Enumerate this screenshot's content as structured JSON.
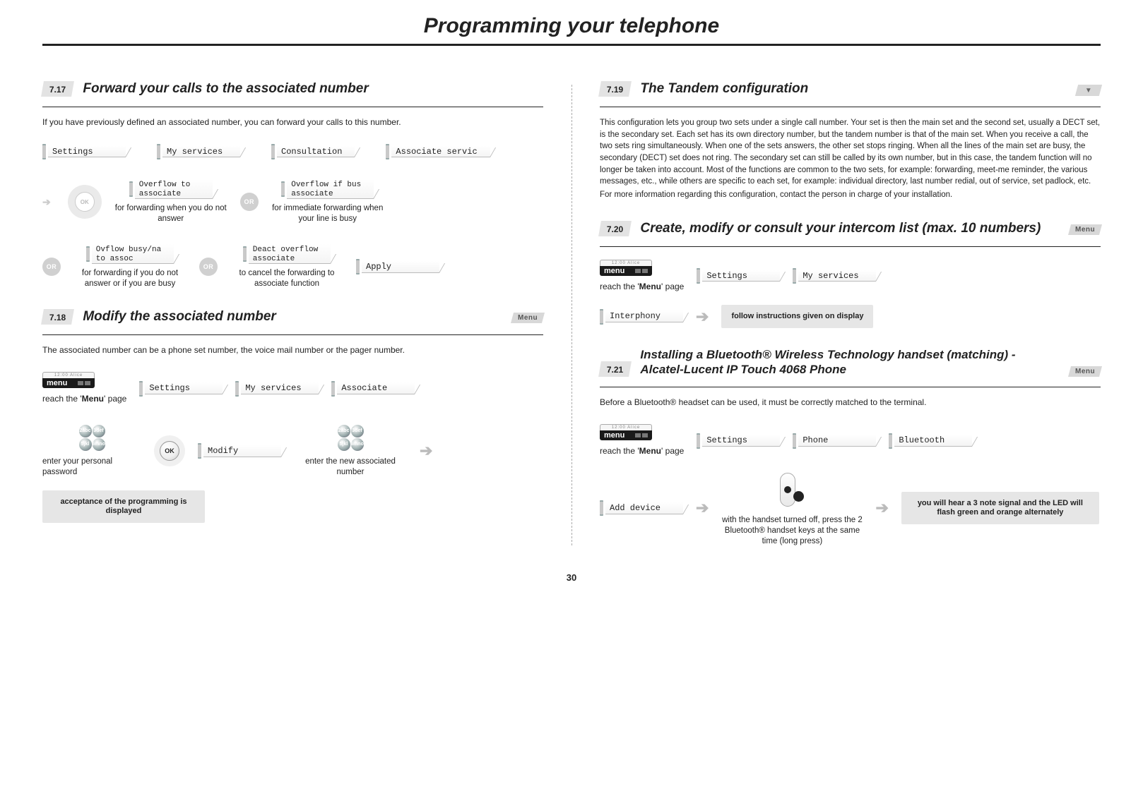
{
  "page_title": "Programming your telephone",
  "page_number": "30",
  "badges": {
    "menu": "Menu",
    "or": "OR",
    "ok": "OK",
    "v": "▼"
  },
  "left": {
    "s17": {
      "num": "7.17",
      "title": "Forward your calls to the associated number",
      "intro": "If you have previously defined an associated number, you can forward your calls to this number.",
      "row1": [
        "Settings",
        "My services",
        "Consultation",
        "Associate servic"
      ],
      "row2a_line1": "Overflow to",
      "row2a_line2": "associate",
      "row2a_cap": "for forwarding when you do not answer",
      "row2b_line1": "Overflow if bus",
      "row2b_line2": "associate",
      "row2b_cap": "for immediate forwarding when your line is busy",
      "row3a_line1": "Ovflow busy/na",
      "row3a_line2": "to assoc",
      "row3a_cap": "for forwarding if you do not answer or if you are busy",
      "row3b_line1": "Deact overflow",
      "row3b_line2": "associate",
      "row3b_cap": "to cancel the forwarding to associate function",
      "row3c": "Apply"
    },
    "s18": {
      "num": "7.18",
      "title": "Modify the associated number",
      "intro": "The associated number can be a phone set number, the voice mail number or the pager number.",
      "row1": [
        "Settings",
        "My services",
        "Associate"
      ],
      "reach": "reach the '",
      "reach_bold": "Menu",
      "reach_after": "' page",
      "modify": "Modify",
      "cap_pw": "enter your personal password",
      "cap_new": "enter the new associated number",
      "result": "acceptance of the programming is displayed"
    }
  },
  "right": {
    "s19": {
      "num": "7.19",
      "title": "The Tandem configuration",
      "body": "This configuration lets you group two sets under a single call number. Your set is then the main set and the second set, usually a DECT set, is the secondary set. Each set has its own directory number, but the tandem number is that of the main set. When you receive a call, the two sets ring simultaneously. When one of the sets answers, the other set stops ringing. When all the lines of the main set are busy, the secondary (DECT) set does not ring. The secondary set can still be called by its own number, but in this case, the tandem function will no longer be taken into account. Most of the functions are common to the two sets, for example: forwarding, meet-me reminder, the various messages, etc., while others are specific to each set, for example: individual directory, last number redial, out of service, set padlock, etc.",
      "body2": "For more information regarding this configuration, contact the person in charge of your installation."
    },
    "s20": {
      "num": "7.20",
      "title": "Create, modify or consult your intercom list (max. 10 numbers)",
      "row1": [
        "Settings",
        "My services"
      ],
      "interphony": "Interphony",
      "follow": "follow instructions given on display",
      "reach": "reach the '",
      "reach_bold": "Menu",
      "reach_after": "' page"
    },
    "s21": {
      "num": "7.21",
      "title": "Installing a Bluetooth® Wireless Technology handset (matching) - Alcatel-Lucent IP Touch 4068 Phone",
      "intro": "Before a Bluetooth® headset can be used, it must be correctly matched to the terminal.",
      "row1": [
        "Settings",
        "Phone",
        "Bluetooth"
      ],
      "reach": "reach the '",
      "reach_bold": "Menu",
      "reach_after": "' page",
      "add_device": "Add device",
      "cap_bt": "with the handset turned off, press the 2 Bluetooth® handset keys at the same time (long press)",
      "result": "you will hear a 3 note signal and the LED will flash green and orange alternately"
    }
  },
  "icons": {
    "menu_label": "menu",
    "menu_top": "12:00      Alice",
    "kp": [
      "2abc",
      "3def",
      "5jkl",
      "6mno"
    ]
  }
}
